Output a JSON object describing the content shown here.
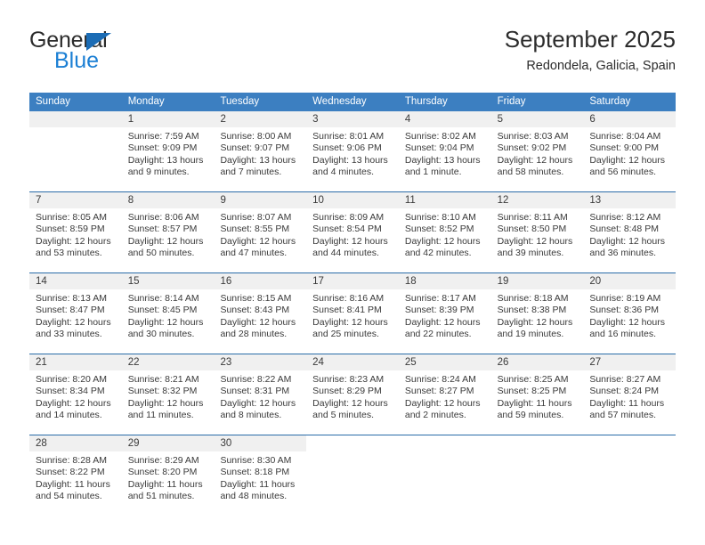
{
  "brand": {
    "name_part1": "General",
    "name_part2": "Blue",
    "accent_color": "#1b7fd4",
    "triangle_color": "#1b6cb5"
  },
  "header": {
    "title": "September 2025",
    "subtitle": "Redondela, Galicia, Spain"
  },
  "theme": {
    "header_row_bg": "#3c7fc1",
    "daynum_band_bg": "#f0f0f0",
    "week_separator": "#2a6ca8",
    "text_color": "#3a3a3a"
  },
  "weekdays": [
    "Sunday",
    "Monday",
    "Tuesday",
    "Wednesday",
    "Thursday",
    "Friday",
    "Saturday"
  ],
  "labels": {
    "sunrise_prefix": "Sunrise:",
    "sunset_prefix": "Sunset:",
    "daylight_prefix": "Daylight:"
  },
  "weeks": [
    {
      "days": [
        {
          "num": "",
          "sunrise": "",
          "sunset": "",
          "daylight_line1": "",
          "daylight_line2": ""
        },
        {
          "num": "1",
          "sunrise": "Sunrise: 7:59 AM",
          "sunset": "Sunset: 9:09 PM",
          "daylight_line1": "Daylight: 13 hours",
          "daylight_line2": "and 9 minutes."
        },
        {
          "num": "2",
          "sunrise": "Sunrise: 8:00 AM",
          "sunset": "Sunset: 9:07 PM",
          "daylight_line1": "Daylight: 13 hours",
          "daylight_line2": "and 7 minutes."
        },
        {
          "num": "3",
          "sunrise": "Sunrise: 8:01 AM",
          "sunset": "Sunset: 9:06 PM",
          "daylight_line1": "Daylight: 13 hours",
          "daylight_line2": "and 4 minutes."
        },
        {
          "num": "4",
          "sunrise": "Sunrise: 8:02 AM",
          "sunset": "Sunset: 9:04 PM",
          "daylight_line1": "Daylight: 13 hours",
          "daylight_line2": "and 1 minute."
        },
        {
          "num": "5",
          "sunrise": "Sunrise: 8:03 AM",
          "sunset": "Sunset: 9:02 PM",
          "daylight_line1": "Daylight: 12 hours",
          "daylight_line2": "and 58 minutes."
        },
        {
          "num": "6",
          "sunrise": "Sunrise: 8:04 AM",
          "sunset": "Sunset: 9:00 PM",
          "daylight_line1": "Daylight: 12 hours",
          "daylight_line2": "and 56 minutes."
        }
      ]
    },
    {
      "days": [
        {
          "num": "7",
          "sunrise": "Sunrise: 8:05 AM",
          "sunset": "Sunset: 8:59 PM",
          "daylight_line1": "Daylight: 12 hours",
          "daylight_line2": "and 53 minutes."
        },
        {
          "num": "8",
          "sunrise": "Sunrise: 8:06 AM",
          "sunset": "Sunset: 8:57 PM",
          "daylight_line1": "Daylight: 12 hours",
          "daylight_line2": "and 50 minutes."
        },
        {
          "num": "9",
          "sunrise": "Sunrise: 8:07 AM",
          "sunset": "Sunset: 8:55 PM",
          "daylight_line1": "Daylight: 12 hours",
          "daylight_line2": "and 47 minutes."
        },
        {
          "num": "10",
          "sunrise": "Sunrise: 8:09 AM",
          "sunset": "Sunset: 8:54 PM",
          "daylight_line1": "Daylight: 12 hours",
          "daylight_line2": "and 44 minutes."
        },
        {
          "num": "11",
          "sunrise": "Sunrise: 8:10 AM",
          "sunset": "Sunset: 8:52 PM",
          "daylight_line1": "Daylight: 12 hours",
          "daylight_line2": "and 42 minutes."
        },
        {
          "num": "12",
          "sunrise": "Sunrise: 8:11 AM",
          "sunset": "Sunset: 8:50 PM",
          "daylight_line1": "Daylight: 12 hours",
          "daylight_line2": "and 39 minutes."
        },
        {
          "num": "13",
          "sunrise": "Sunrise: 8:12 AM",
          "sunset": "Sunset: 8:48 PM",
          "daylight_line1": "Daylight: 12 hours",
          "daylight_line2": "and 36 minutes."
        }
      ]
    },
    {
      "days": [
        {
          "num": "14",
          "sunrise": "Sunrise: 8:13 AM",
          "sunset": "Sunset: 8:47 PM",
          "daylight_line1": "Daylight: 12 hours",
          "daylight_line2": "and 33 minutes."
        },
        {
          "num": "15",
          "sunrise": "Sunrise: 8:14 AM",
          "sunset": "Sunset: 8:45 PM",
          "daylight_line1": "Daylight: 12 hours",
          "daylight_line2": "and 30 minutes."
        },
        {
          "num": "16",
          "sunrise": "Sunrise: 8:15 AM",
          "sunset": "Sunset: 8:43 PM",
          "daylight_line1": "Daylight: 12 hours",
          "daylight_line2": "and 28 minutes."
        },
        {
          "num": "17",
          "sunrise": "Sunrise: 8:16 AM",
          "sunset": "Sunset: 8:41 PM",
          "daylight_line1": "Daylight: 12 hours",
          "daylight_line2": "and 25 minutes."
        },
        {
          "num": "18",
          "sunrise": "Sunrise: 8:17 AM",
          "sunset": "Sunset: 8:39 PM",
          "daylight_line1": "Daylight: 12 hours",
          "daylight_line2": "and 22 minutes."
        },
        {
          "num": "19",
          "sunrise": "Sunrise: 8:18 AM",
          "sunset": "Sunset: 8:38 PM",
          "daylight_line1": "Daylight: 12 hours",
          "daylight_line2": "and 19 minutes."
        },
        {
          "num": "20",
          "sunrise": "Sunrise: 8:19 AM",
          "sunset": "Sunset: 8:36 PM",
          "daylight_line1": "Daylight: 12 hours",
          "daylight_line2": "and 16 minutes."
        }
      ]
    },
    {
      "days": [
        {
          "num": "21",
          "sunrise": "Sunrise: 8:20 AM",
          "sunset": "Sunset: 8:34 PM",
          "daylight_line1": "Daylight: 12 hours",
          "daylight_line2": "and 14 minutes."
        },
        {
          "num": "22",
          "sunrise": "Sunrise: 8:21 AM",
          "sunset": "Sunset: 8:32 PM",
          "daylight_line1": "Daylight: 12 hours",
          "daylight_line2": "and 11 minutes."
        },
        {
          "num": "23",
          "sunrise": "Sunrise: 8:22 AM",
          "sunset": "Sunset: 8:31 PM",
          "daylight_line1": "Daylight: 12 hours",
          "daylight_line2": "and 8 minutes."
        },
        {
          "num": "24",
          "sunrise": "Sunrise: 8:23 AM",
          "sunset": "Sunset: 8:29 PM",
          "daylight_line1": "Daylight: 12 hours",
          "daylight_line2": "and 5 minutes."
        },
        {
          "num": "25",
          "sunrise": "Sunrise: 8:24 AM",
          "sunset": "Sunset: 8:27 PM",
          "daylight_line1": "Daylight: 12 hours",
          "daylight_line2": "and 2 minutes."
        },
        {
          "num": "26",
          "sunrise": "Sunrise: 8:25 AM",
          "sunset": "Sunset: 8:25 PM",
          "daylight_line1": "Daylight: 11 hours",
          "daylight_line2": "and 59 minutes."
        },
        {
          "num": "27",
          "sunrise": "Sunrise: 8:27 AM",
          "sunset": "Sunset: 8:24 PM",
          "daylight_line1": "Daylight: 11 hours",
          "daylight_line2": "and 57 minutes."
        }
      ]
    },
    {
      "days": [
        {
          "num": "28",
          "sunrise": "Sunrise: 8:28 AM",
          "sunset": "Sunset: 8:22 PM",
          "daylight_line1": "Daylight: 11 hours",
          "daylight_line2": "and 54 minutes."
        },
        {
          "num": "29",
          "sunrise": "Sunrise: 8:29 AM",
          "sunset": "Sunset: 8:20 PM",
          "daylight_line1": "Daylight: 11 hours",
          "daylight_line2": "and 51 minutes."
        },
        {
          "num": "30",
          "sunrise": "Sunrise: 8:30 AM",
          "sunset": "Sunset: 8:18 PM",
          "daylight_line1": "Daylight: 11 hours",
          "daylight_line2": "and 48 minutes."
        },
        {
          "num": "",
          "sunrise": "",
          "sunset": "",
          "daylight_line1": "",
          "daylight_line2": ""
        },
        {
          "num": "",
          "sunrise": "",
          "sunset": "",
          "daylight_line1": "",
          "daylight_line2": ""
        },
        {
          "num": "",
          "sunrise": "",
          "sunset": "",
          "daylight_line1": "",
          "daylight_line2": ""
        },
        {
          "num": "",
          "sunrise": "",
          "sunset": "",
          "daylight_line1": "",
          "daylight_line2": ""
        }
      ]
    }
  ]
}
